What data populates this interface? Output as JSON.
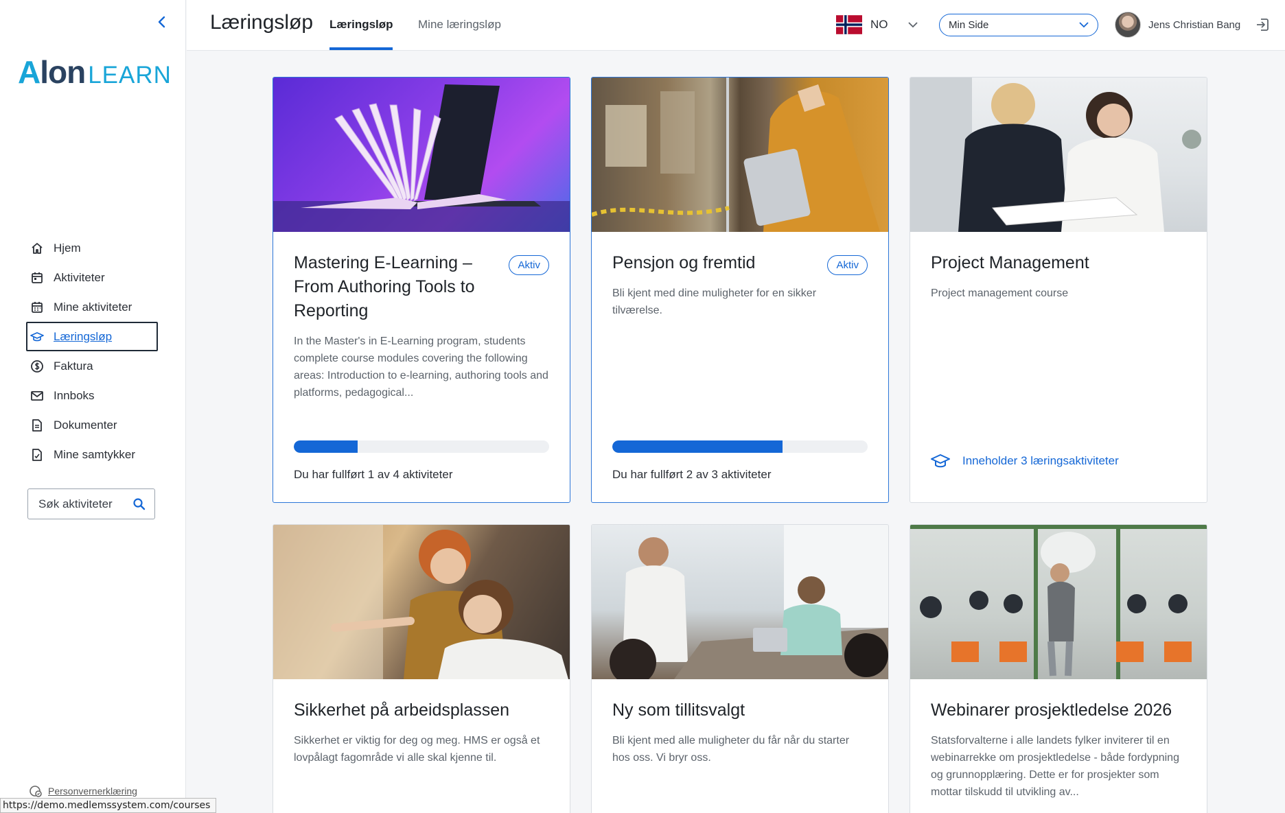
{
  "sidebar": {
    "logo": {
      "part1_a": "A",
      "part1_rest": "lon",
      "part2": "LEARN"
    },
    "nav": [
      {
        "label": "Hjem",
        "icon": "home-icon"
      },
      {
        "label": "Aktiviteter",
        "icon": "calendar-icon"
      },
      {
        "label": "Mine aktiviteter",
        "icon": "calendar-grid-icon"
      },
      {
        "label": "Læringsløp",
        "icon": "graduation-cap-icon",
        "active": true
      },
      {
        "label": "Faktura",
        "icon": "dollar-icon"
      },
      {
        "label": "Innboks",
        "icon": "mail-icon"
      },
      {
        "label": "Dokumenter",
        "icon": "document-icon"
      },
      {
        "label": "Mine samtykker",
        "icon": "consent-icon"
      }
    ],
    "search": {
      "placeholder": "Søk aktiviteter"
    },
    "privacy_label": "Personvernerklæring"
  },
  "status_url": "https://demo.medlemssystem.com/courses",
  "header": {
    "title": "Læringsløp",
    "tabs": [
      {
        "label": "Læringsløp",
        "active": true
      },
      {
        "label": "Mine læringsløp",
        "active": false
      }
    ],
    "language": {
      "code": "NO",
      "flag": "norway-flag-icon"
    },
    "site_select": {
      "value": "Min Side"
    },
    "user": {
      "name": "Jens Christian Bang"
    }
  },
  "cards": [
    {
      "title": "Mastering E-Learning – From Authoring Tools to Reporting",
      "badge": "Aktiv",
      "description": "In the Master's in E-Learning program, students complete course modules covering the following areas: Introduction to e-learning, authoring tools and platforms, pedagogical...",
      "progress": 0.25,
      "progress_text": "Du har fullført 1 av 4 aktiviteter"
    },
    {
      "title": "Pensjon og fremtid",
      "badge": "Aktiv",
      "description": "Bli kjent med dine muligheter for en sikker tilværelse.",
      "progress": 0.667,
      "progress_text": "Du har fullført 2 av 3 aktiviteter"
    },
    {
      "title": "Project Management",
      "description": "Project management course",
      "contains_text": "Inneholder 3 læringsaktiviteter"
    },
    {
      "title": "Sikkerhet på arbeidsplassen",
      "description": "Sikkerhet er viktig for deg og meg. HMS er også et lovpålagt fagområde vi alle skal kjenne til."
    },
    {
      "title": "Ny som tillitsvalgt",
      "description": "Bli kjent med alle muligheter du får når du starter hos oss. Vi bryr oss."
    },
    {
      "title": "Webinarer prosjektledelse 2026",
      "description": "Statsforvalterne i alle landets fylker inviterer til en webinarrekke om prosjektledelse - både fordypning og grunnopplæring. Dette er for prosjekter som mottar tilskudd til utvikling av..."
    }
  ],
  "colors": {
    "accent": "#1467d6",
    "logo_blue": "#19a5d8",
    "logo_dark": "#2a4260"
  }
}
